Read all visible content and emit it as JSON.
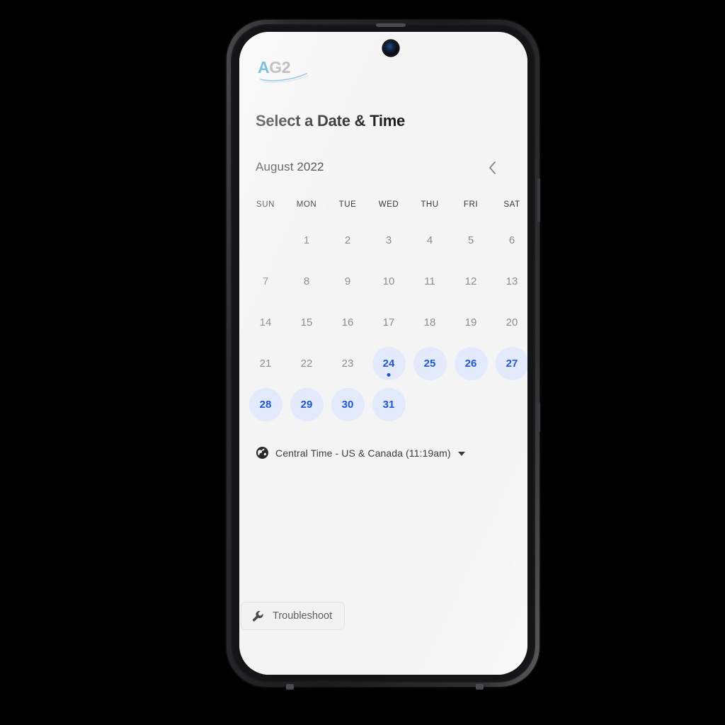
{
  "brand": {
    "name_part_a": "A",
    "name_part_g2": "G2",
    "icon": "ag2-logo"
  },
  "header": {
    "title": "Select a Date & Time"
  },
  "calendar": {
    "month_label": "August 2022",
    "prev_label": "‹",
    "next_label": "›",
    "prev_icon": "chevron-left-icon",
    "next_icon": "chevron-right-icon",
    "prev_enabled": false,
    "next_enabled": true,
    "weekdays": [
      "SUN",
      "MON",
      "TUE",
      "WED",
      "THU",
      "FRI",
      "SAT"
    ],
    "weeks": [
      [
        {
          "label": "",
          "state": "empty"
        },
        {
          "label": "1",
          "state": "unavailable"
        },
        {
          "label": "2",
          "state": "unavailable"
        },
        {
          "label": "3",
          "state": "unavailable"
        },
        {
          "label": "4",
          "state": "unavailable"
        },
        {
          "label": "5",
          "state": "unavailable"
        },
        {
          "label": "6",
          "state": "unavailable"
        }
      ],
      [
        {
          "label": "7",
          "state": "unavailable"
        },
        {
          "label": "8",
          "state": "unavailable"
        },
        {
          "label": "9",
          "state": "unavailable"
        },
        {
          "label": "10",
          "state": "unavailable"
        },
        {
          "label": "11",
          "state": "unavailable"
        },
        {
          "label": "12",
          "state": "unavailable"
        },
        {
          "label": "13",
          "state": "unavailable"
        }
      ],
      [
        {
          "label": "14",
          "state": "unavailable"
        },
        {
          "label": "15",
          "state": "unavailable"
        },
        {
          "label": "16",
          "state": "unavailable"
        },
        {
          "label": "17",
          "state": "unavailable"
        },
        {
          "label": "18",
          "state": "unavailable"
        },
        {
          "label": "19",
          "state": "unavailable"
        },
        {
          "label": "20",
          "state": "unavailable"
        }
      ],
      [
        {
          "label": "21",
          "state": "unavailable"
        },
        {
          "label": "22",
          "state": "unavailable"
        },
        {
          "label": "23",
          "state": "unavailable"
        },
        {
          "label": "24",
          "state": "available",
          "today": true
        },
        {
          "label": "25",
          "state": "available"
        },
        {
          "label": "26",
          "state": "available"
        },
        {
          "label": "27",
          "state": "available"
        }
      ],
      [
        {
          "label": "28",
          "state": "available"
        },
        {
          "label": "29",
          "state": "available"
        },
        {
          "label": "30",
          "state": "available"
        },
        {
          "label": "31",
          "state": "available"
        },
        {
          "label": "",
          "state": "empty"
        },
        {
          "label": "",
          "state": "empty"
        },
        {
          "label": "",
          "state": "empty"
        }
      ]
    ]
  },
  "timezone": {
    "icon": "globe-icon",
    "label": "Central Time - US & Canada (11:19am)",
    "caret_icon": "caret-down-icon"
  },
  "troubleshoot": {
    "icon": "wrench-icon",
    "label": "Troubleshoot"
  },
  "colors": {
    "accent_blue": "#1f56e0",
    "accent_blue_soft": "#e2eafc",
    "next_chevron": "#4a7ef5",
    "prev_chevron": "#8a8a8e",
    "screen_bg": "#f4f4f4",
    "text_dark": "#1d1d1f",
    "text_muted": "#8c8c90",
    "brand_teal": "#1494c8",
    "brand_gray": "#9a9a9a"
  }
}
